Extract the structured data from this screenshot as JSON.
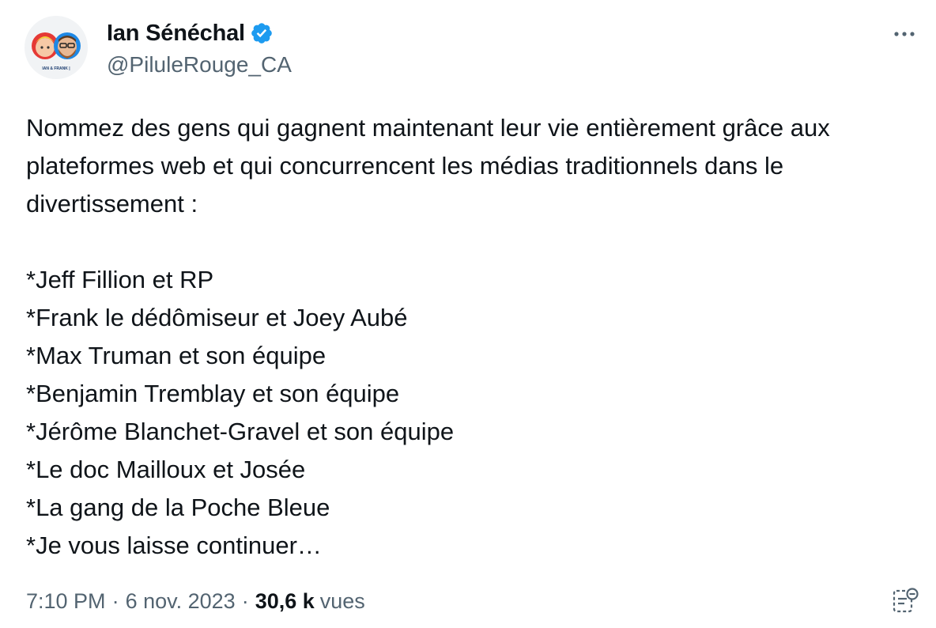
{
  "author": {
    "display_name": "Ian Sénéchal",
    "handle": "@PiluleRouge_CA",
    "verified": true,
    "avatar_caption": "IAN & FRANK"
  },
  "tweet": {
    "text": "Nommez des gens qui gagnent maintenant leur vie entièrement grâce aux plateformes web et qui concurrencent les médias traditionnels dans le divertissement :\n\n*Jeff Fillion et RP\n*Frank le dédômiseur et Joey Aubé\n*Max Truman et son équipe\n*Benjamin Tremblay et son équipe\n*Jérôme Blanchet-Gravel et son équipe\n*Le doc Mailloux et Josée\n*La gang de la Poche Bleue\n*Je vous laisse continuer…"
  },
  "meta": {
    "time": "7:10 PM",
    "separator": "·",
    "date": "6 nov. 2023",
    "views_count": "30,6 k",
    "views_label": "vues"
  },
  "icons": {
    "more": "more-horizontal-icon",
    "verified": "verified-badge-icon",
    "notes": "community-notes-icon"
  },
  "colors": {
    "text_primary": "#0f1419",
    "text_secondary": "#536471",
    "verified_blue": "#1d9bf0"
  }
}
